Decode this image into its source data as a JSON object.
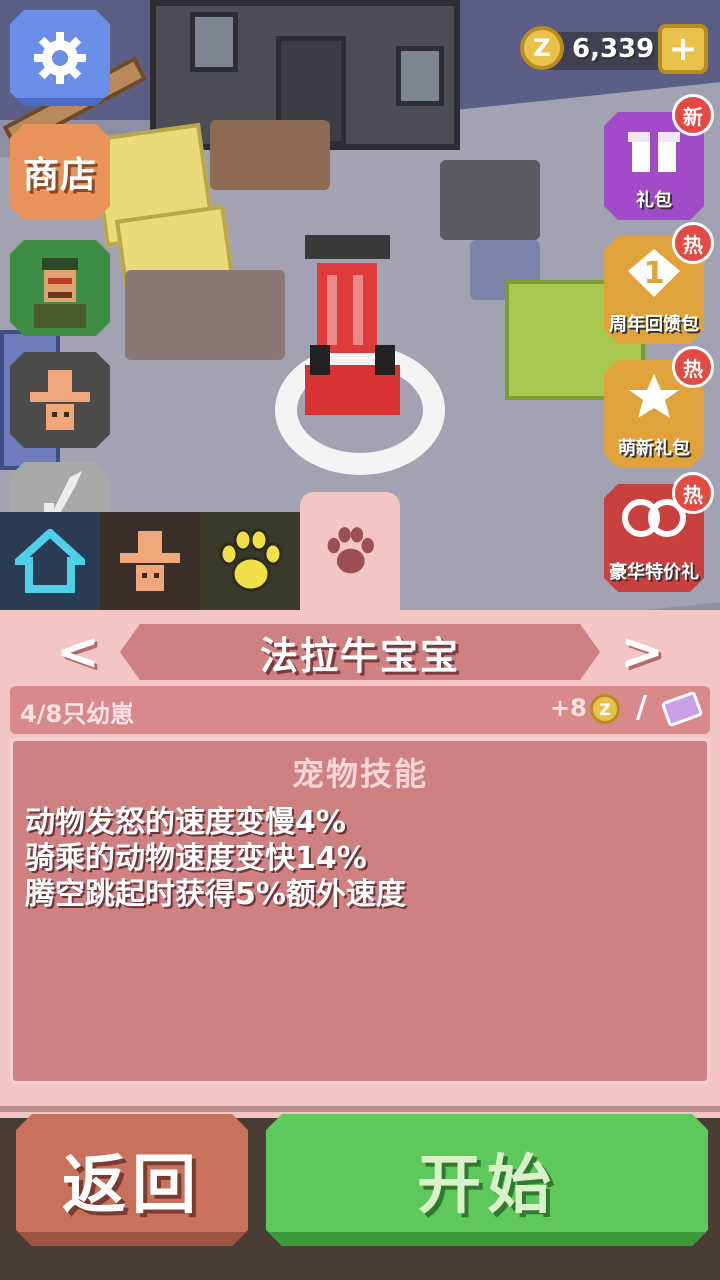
{
  "hud": {
    "coin_symbol": "Z",
    "coin_amount": "6,339",
    "add_label": "+"
  },
  "left_menu": {
    "shop_label": "商店"
  },
  "promos": [
    {
      "label": "礼包",
      "badge": "新",
      "icon": "gift-box-icon"
    },
    {
      "label": "周年回馈包",
      "badge": "热",
      "icon": "anniversary-1-icon"
    },
    {
      "label": "萌新礼包",
      "badge": "热",
      "icon": "stars-icon"
    },
    {
      "label": "豪华特价礼",
      "badge": "热",
      "icon": "lasso-icon"
    }
  ],
  "tabs": [
    {
      "icon": "home-icon"
    },
    {
      "icon": "cowboy-hat-icon"
    },
    {
      "icon": "paw-icon"
    },
    {
      "icon": "paw-icon-selected"
    }
  ],
  "pet": {
    "prev_label": "<",
    "next_label": ">",
    "name": "法拉牛宝宝",
    "babies": "4/8只幼崽",
    "bonus": "+8",
    "bonus_coin_symbol": "Z",
    "slash": "/",
    "skills_title": "宠物技能",
    "skills": [
      "动物发怒的速度变慢4%",
      "骑乘的动物速度变快14%",
      "腾空跳起时获得5%额外速度"
    ]
  },
  "buttons": {
    "back": "返回",
    "start": "开始"
  },
  "colors": {
    "panel": "#f3c6c3",
    "name_bar": "#cf8081",
    "start": "#5ec85c",
    "back": "#c8715b",
    "badge": "#e24a43"
  }
}
